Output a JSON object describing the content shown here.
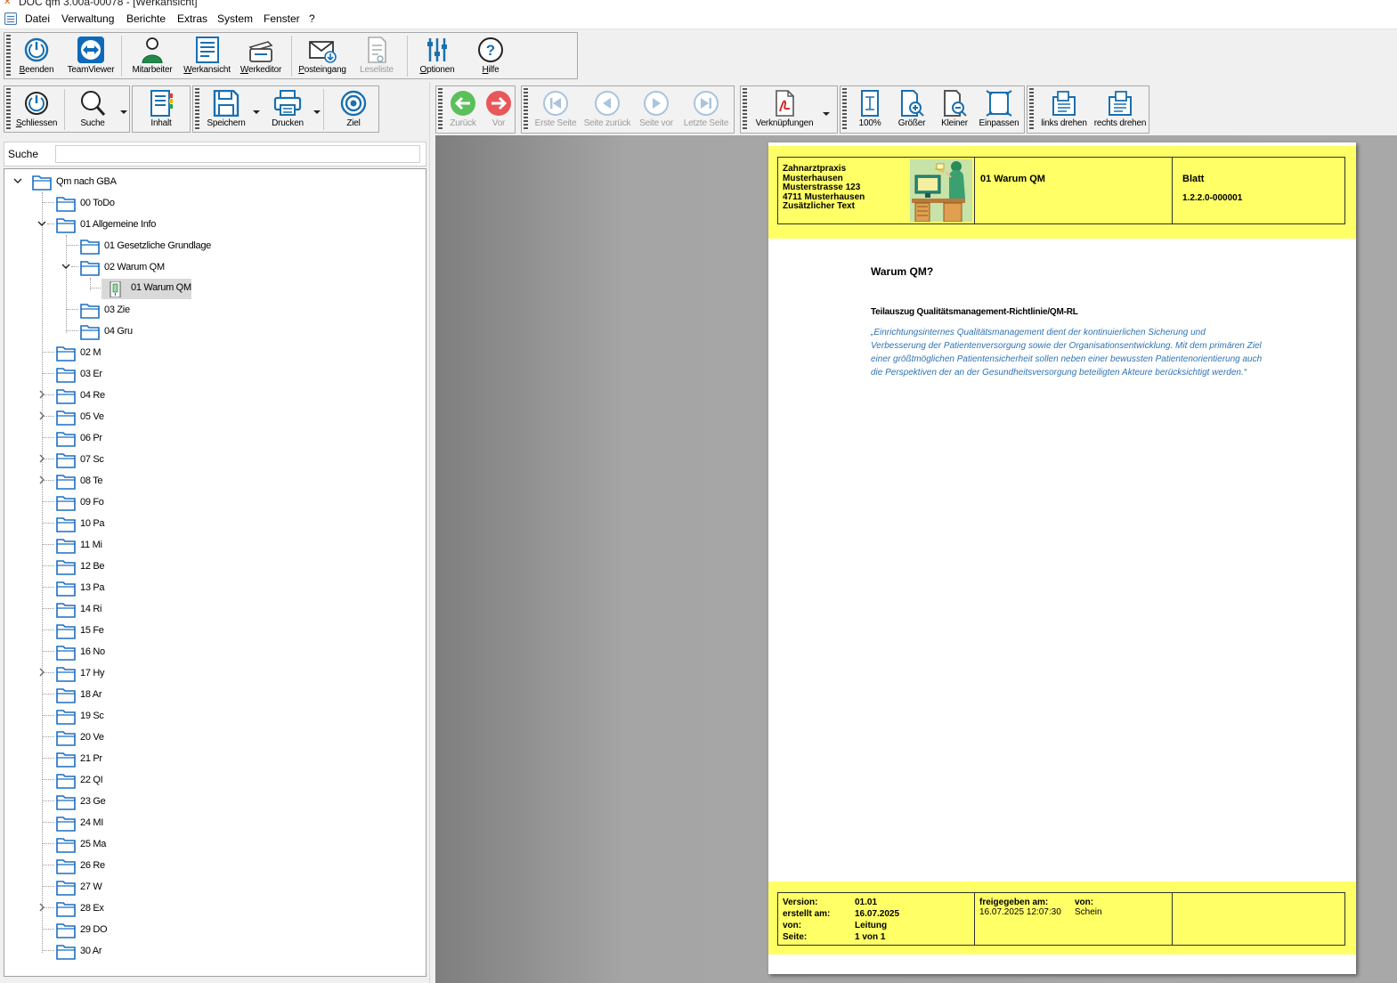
{
  "window": {
    "title": "DOC qm 3.00a-00078 - [Werkansicht]"
  },
  "menu": [
    "Datei",
    "Verwaltung",
    "Berichte",
    "Extras",
    "System",
    "Fenster",
    "?"
  ],
  "main_toolbar": {
    "beenden": "Beenden",
    "teamviewer": "TeamViewer",
    "mitarbeiter": "Mitarbeiter",
    "werkansicht": "Werkansicht",
    "werkeditor": "Werkeditor",
    "posteingang": "Posteingang",
    "leseliste": "Leseliste",
    "optionen": "Optionen",
    "hilfe": "Hilfe"
  },
  "left_toolbar": {
    "schliessen": "Schliessen",
    "suche": "Suche",
    "inhalt": "Inhalt",
    "speichern": "Speichern",
    "drucken": "Drucken",
    "ziel": "Ziel"
  },
  "search": {
    "label": "Suche",
    "value": ""
  },
  "tree": {
    "root": "Qm nach GBA",
    "todo": "00 ToDo",
    "allgemein": "01 Allgemeine Info",
    "gesetz": "01 Gesetzliche Grundlage",
    "warum_folder": "02 Warum QM",
    "warum_doc": "01 Warum QM",
    "zie": "03 Zie",
    "gru": "04 Gru",
    "top": [
      "02 M",
      "03 Er",
      "04 Re",
      "05 Ve",
      "06 Pr",
      "07 Sc",
      "08 Te",
      "09 Fo",
      "10 Pa",
      "11 Mi",
      "12 Be",
      "13 Pa",
      "14 Ri",
      "15 Fe",
      "16 No",
      "17 Hy",
      "18 Ar",
      "19 Sc",
      "20 Ve",
      "21 Pr",
      "22 QI",
      "23 Ge",
      "24 MI",
      "25 Ma",
      "26 Re",
      "27 W",
      "28 Ex",
      "29 DO",
      "30 Ar"
    ]
  },
  "viewer_toolbar": {
    "zurueck": "Zurück",
    "vor": "Vor",
    "erste_seite": "Erste Seite",
    "seite_zurueck": "Seite zurück",
    "seite_vor": "Seite vor",
    "letzte_seite": "Letzte Seite",
    "verknuepfungen": "Verknüpfungen",
    "zoom100": "100%",
    "groesser": "Größer",
    "kleiner": "Kleiner",
    "einpassen": "Einpassen",
    "links_drehen": "links drehen",
    "rechts_drehen": "rechts drehen"
  },
  "document": {
    "practice": [
      "Zahnarztpraxis",
      "Musterhausen",
      "Musterstrasse 123",
      "4711 Musterhausen",
      "Zusätzlicher Text"
    ],
    "header_title": "01 Warum QM",
    "blatt_label": "Blatt",
    "blatt_number": "1.2.2.0-000001",
    "title": "Warum QM?",
    "subtitle": "Teilauszug Qualitätsmanagement-Richtlinie/QM-RL",
    "quote": "„Einrichtungsinternes Qualitätsmanagement dient der kontinuierlichen Sicherung und Verbesserung der Patientenversorgung sowie der Organisationsentwicklung. Mit dem primären Ziel einer größtmöglichen Patientensicherheit sollen neben einer bewussten Patientenorientierung auch die Perspektiven der an der Gesundheitsversorgung beteiligten Akteure berücksichtigt werden.“",
    "footer": {
      "version_label": "Version:",
      "version": "01.01",
      "erstellt_label": "erstellt am:",
      "erstellt": "16.07.2025",
      "von_label": "von:",
      "von": "Leitung",
      "seite_label": "Seite:",
      "seite": "1 von 1",
      "freigegeben_label": "freigegeben am:",
      "freigegeben": "16.07.2025 12:07:30",
      "von2_label": "von:",
      "von2": "Schein"
    }
  },
  "colors": {
    "header_yellow": "#ffff66",
    "quote_blue": "#2e74b5",
    "icon_blue": "#1a6fb0",
    "folder_blue": "#1b6ec2"
  }
}
